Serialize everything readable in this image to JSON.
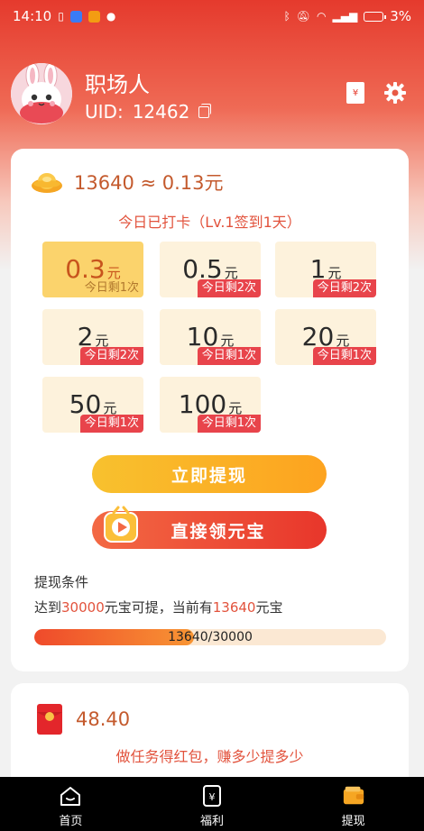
{
  "status_bar": {
    "time": "14:10",
    "battery": "3%"
  },
  "profile": {
    "username": "职场人",
    "uid_label": "UID:",
    "uid_value": "12462"
  },
  "balance": {
    "coins": "13640 ≈ 0.13元"
  },
  "checkin": {
    "text": "今日已打卡（Lv.1签到1天）"
  },
  "tiles": [
    {
      "amount": "0.3",
      "unit": "元",
      "remain": "今日剩1次",
      "selected": true
    },
    {
      "amount": "0.5",
      "unit": "元",
      "remain": "今日剩2次"
    },
    {
      "amount": "1",
      "unit": "元",
      "remain": "今日剩2次"
    },
    {
      "amount": "2",
      "unit": "元",
      "remain": "今日剩2次"
    },
    {
      "amount": "10",
      "unit": "元",
      "remain": "今日剩1次"
    },
    {
      "amount": "20",
      "unit": "元",
      "remain": "今日剩1次"
    },
    {
      "amount": "50",
      "unit": "元",
      "remain": "今日剩1次"
    },
    {
      "amount": "100",
      "unit": "元",
      "remain": "今日剩1次"
    }
  ],
  "buttons": {
    "withdraw": "立即提现",
    "collect": "直接领元宝"
  },
  "conditions": {
    "title": "提现条件",
    "prefix": "达到",
    "required": "30000",
    "middle": "元宝可提，当前有",
    "current": "13640",
    "suffix": "元宝",
    "progress_text": "13640/30000",
    "progress_fraction": 0.4547
  },
  "red_packet": {
    "amount": "48.40",
    "task_text": "做任务得红包，赚多少提多少"
  },
  "nav": {
    "home": "首页",
    "welfare": "福利",
    "withdraw": "提现"
  },
  "colors": {
    "primary_red": "#e53a2d",
    "accent_orange": "#f89533",
    "tile_bg": "#fdf2dc",
    "tile_selected": "#fbd36c",
    "badge_red": "#e8444b"
  }
}
